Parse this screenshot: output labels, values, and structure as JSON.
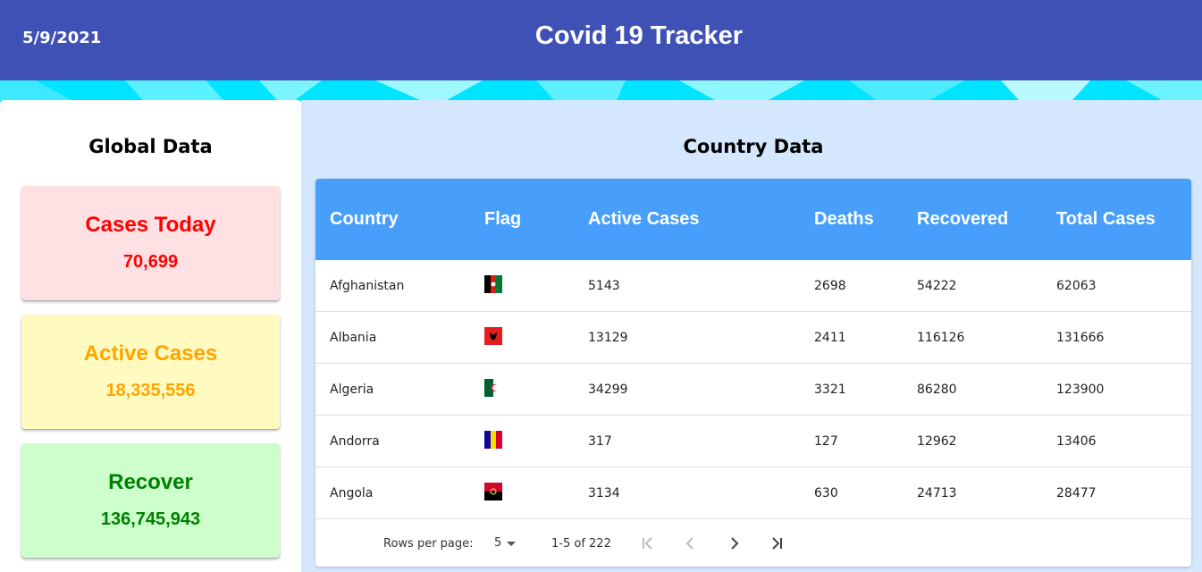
{
  "header": {
    "date": "5/9/2021",
    "title": "Covid 19 Tracker"
  },
  "global": {
    "title": "Global Data",
    "cases_today": {
      "label": "Cases Today",
      "value": "70,699"
    },
    "active_cases": {
      "label": "Active Cases",
      "value": "18,335,556"
    },
    "recover": {
      "label": "Recover",
      "value": "136,745,943"
    }
  },
  "country": {
    "title": "Country Data",
    "columns": [
      "Country",
      "Flag",
      "Active Cases",
      "Deaths",
      "Recovered",
      "Total Cases"
    ],
    "rows": [
      {
        "country": "Afghanistan",
        "flag": "afghanistan-flag",
        "active": "5143",
        "deaths": "2698",
        "recovered": "54222",
        "total": "62063"
      },
      {
        "country": "Albania",
        "flag": "albania-flag",
        "active": "13129",
        "deaths": "2411",
        "recovered": "116126",
        "total": "131666"
      },
      {
        "country": "Algeria",
        "flag": "algeria-flag",
        "active": "34299",
        "deaths": "3321",
        "recovered": "86280",
        "total": "123900"
      },
      {
        "country": "Andorra",
        "flag": "andorra-flag",
        "active": "317",
        "deaths": "127",
        "recovered": "12962",
        "total": "13406"
      },
      {
        "country": "Angola",
        "flag": "angola-flag",
        "active": "3134",
        "deaths": "630",
        "recovered": "24713",
        "total": "28477"
      }
    ],
    "pagination": {
      "rows_per_page_label": "Rows per page:",
      "rows_per_page": "5",
      "range": "1-5 of 222"
    }
  },
  "colors": {
    "appbar": "#3f51b5",
    "table_header": "#479ffb",
    "cases_today": "#ff0000",
    "active_cases": "#ffa500",
    "recover": "#008000"
  }
}
